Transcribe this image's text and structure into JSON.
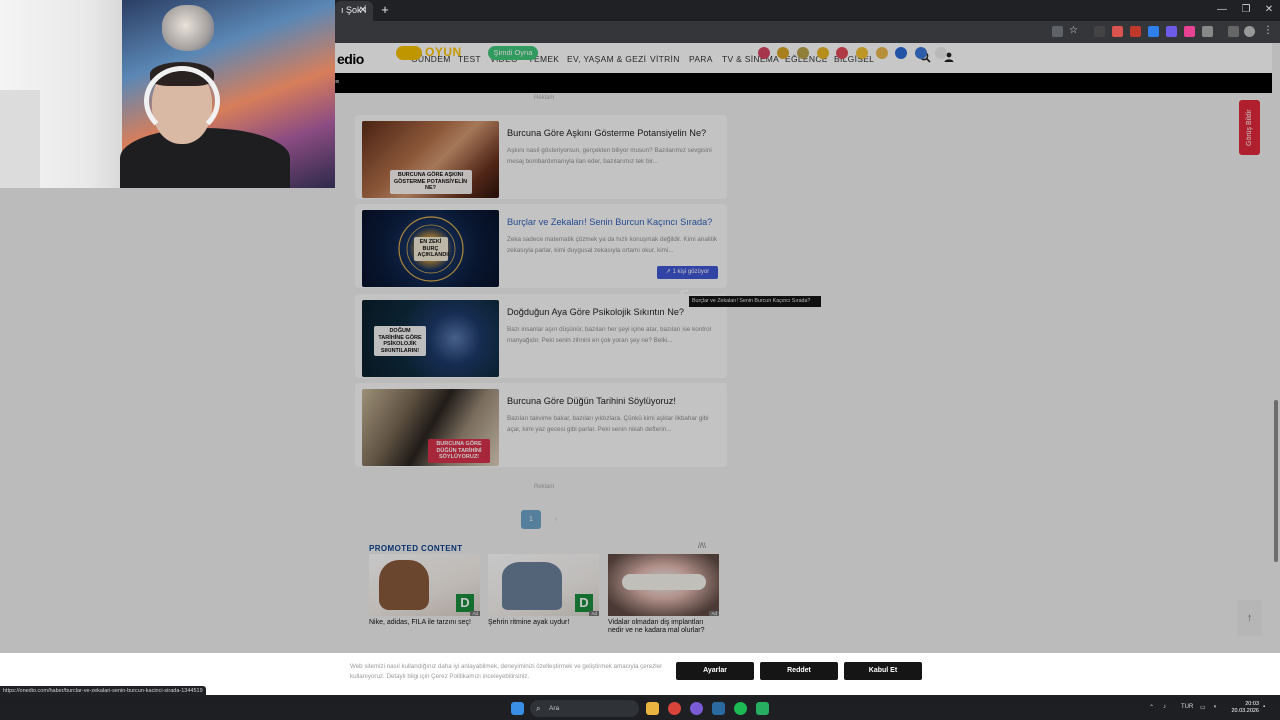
{
  "browser": {
    "tab_title": "ı Şok İ",
    "new_tab_symbol": "+",
    "close_symbol": "✕"
  },
  "site": {
    "logo": "edio",
    "nav": [
      "GÜNDEM",
      "TEST",
      "VİDEO",
      "YEMEK",
      "EV, YAŞAM & GEZİ",
      "VİTRİN",
      "PARA",
      "TV & SİNEMA",
      "EĞLENCE",
      "BİLGİSEL"
    ],
    "game_bar": {
      "brand": "onedio",
      "section": "OYUN",
      "play_label": "Şimdi Oyna"
    },
    "ad_label": "Reklam",
    "articles": [
      {
        "title": "Burcuna Göre Aşkını Gösterme Potansiyelin Ne?",
        "desc": "Aşkını nasıl gösteriyorsun, gerçekten biliyor musun? Bazılarımız sevgisini mesaj bombardımanıyla ilan eder, bazılarımız tek bir...",
        "thumb_text": "BURCUNA GÖRE AŞKINI GÖSTERME POTANSİYELİN NE?"
      },
      {
        "title": "Burçlar ve Zekaları! Senin Burcun Kaçıncı Sırada?",
        "desc": "Zeka sadece matematik çözmek ya da hızlı konuşmak değildir. Kimi analitik zekasıyla parlar, kimi duygusal zekasıyla ortamı okur, kimi...",
        "thumb_text": "EN ZEKİ BURÇ AÇIKLANDI!",
        "trend_label": "1 kişi gözüyor",
        "tooltip": "Burçlar ve Zekaları! Senin Burcun Kaçıncı Sırada?"
      },
      {
        "title": "Doğduğun Aya Göre Psikolojik Sıkıntın Ne?",
        "desc": "Bazı insanlar aşırı düşünür, bazıları her şeyi içine atar, bazıları ise kontrol manyağıdır. Peki senin zihnini en çok yoran şey ne? Belki...",
        "thumb_text": "DOĞUM TARİHİNE GÖRE PSİKOLOJİK SIKINTILARIN!"
      },
      {
        "title": "Burcuna Göre Düğün Tarihini Söylüyoruz!",
        "desc": "Bazıları takvime bakar, bazıları yıldızlara. Çünkü kimi aşklar ilkbahar gibi açar, kimi yaz gecesi gibi parlar. Peki senin nikah defterin...",
        "thumb_text": "BURCUNA GÖRE DÜĞÜN TARİHİNİ SÖYLÜYORUZ!"
      }
    ],
    "pagination": {
      "current": "1",
      "next": "›"
    },
    "promoted": {
      "title": "PROMOTED CONTENT",
      "mark": "//\\\\",
      "ad_tag": "Ad",
      "d_logo": "D",
      "items": [
        {
          "text": "Nike, adidas, FILA ile tarzını seç!"
        },
        {
          "text": "Şehrin ritmine ayak uydur!"
        },
        {
          "text": "Vidalar olmadan diş implantları nedir ve ne kadara mal olurlar?"
        }
      ]
    },
    "feedback_tab": "Görüş Bildir",
    "scroll_top_symbol": "↑"
  },
  "cookie": {
    "text": "Web sitemizi nasıl kullandığınız daha iyi anlayabilmek, deneyiminizi özelleştirmek ve geliştirmek amacıyla çerezler kullanıyoruz. Detaylı bilgi için Çerez Politikamızı inceleyebilirsiniz.",
    "buttons": [
      "Ayarlar",
      "Reddet",
      "Kabul Et"
    ]
  },
  "status_url": "https://onedio.com/haber/burclar-ve-zekalari-senin-burcun-kacinci-sirada-1344519",
  "taskbar": {
    "search_placeholder": "Ara",
    "lang": "TUR",
    "time": "20:03",
    "date": "20.03.2026"
  },
  "colors": {
    "accent_red": "#e2283a",
    "trend_blue": "#3f57d4",
    "play_green": "#3fc67a",
    "oyun_yellow": "#ffc400",
    "promo_blue": "#0b3f8e"
  }
}
